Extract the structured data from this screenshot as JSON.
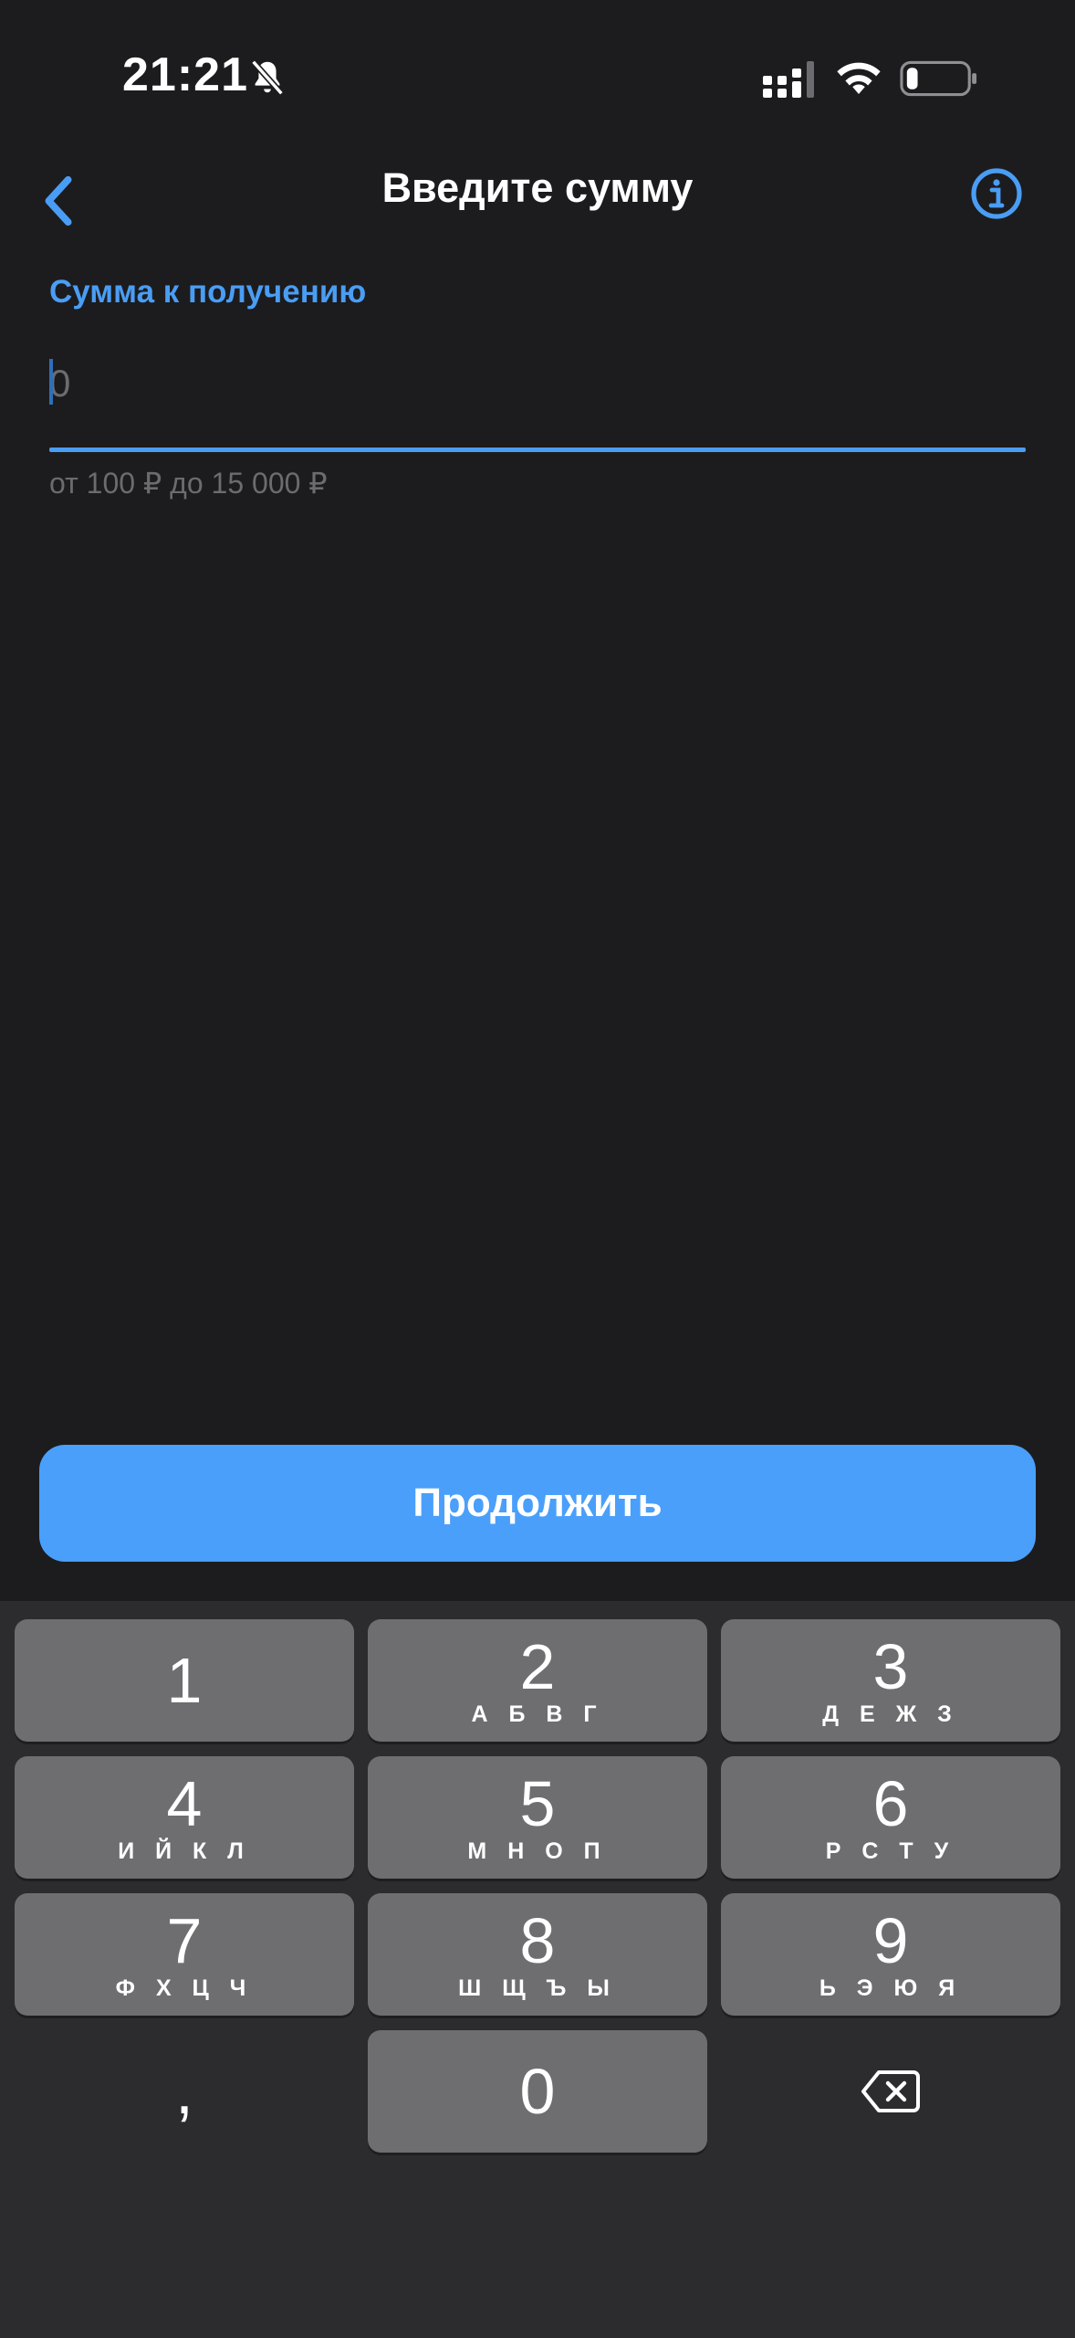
{
  "status_bar": {
    "time": "21:21",
    "icons": [
      "bell-slash-icon",
      "signal-icon",
      "wifi-icon",
      "battery-icon"
    ]
  },
  "nav": {
    "title": "Введите сумму",
    "back_icon": "chevron-left-icon",
    "info_icon": "info-circle-icon"
  },
  "amount": {
    "label": "Сумма к получению",
    "placeholder": "0",
    "value": "",
    "hint": "от 100 ₽ до 15 000 ₽"
  },
  "continue_button": {
    "label": "Продолжить"
  },
  "keyboard": {
    "keys": [
      {
        "digit": "1",
        "letters": ""
      },
      {
        "digit": "2",
        "letters": "А Б В Г"
      },
      {
        "digit": "3",
        "letters": "Д Е Ж З"
      },
      {
        "digit": "4",
        "letters": "И Й К Л"
      },
      {
        "digit": "5",
        "letters": "М Н О П"
      },
      {
        "digit": "6",
        "letters": "Р С Т У"
      },
      {
        "digit": "7",
        "letters": "Ф Х Ц Ч"
      },
      {
        "digit": "8",
        "letters": "Ш Щ Ъ Ы"
      },
      {
        "digit": "9",
        "letters": "Ь Э Ю Я"
      },
      {
        "digit": "0",
        "letters": ""
      }
    ],
    "comma": ",",
    "delete_icon": "backspace-icon"
  },
  "colors": {
    "accent": "#4a9df4",
    "background": "#1c1c1e",
    "key": "#6e6e70"
  }
}
